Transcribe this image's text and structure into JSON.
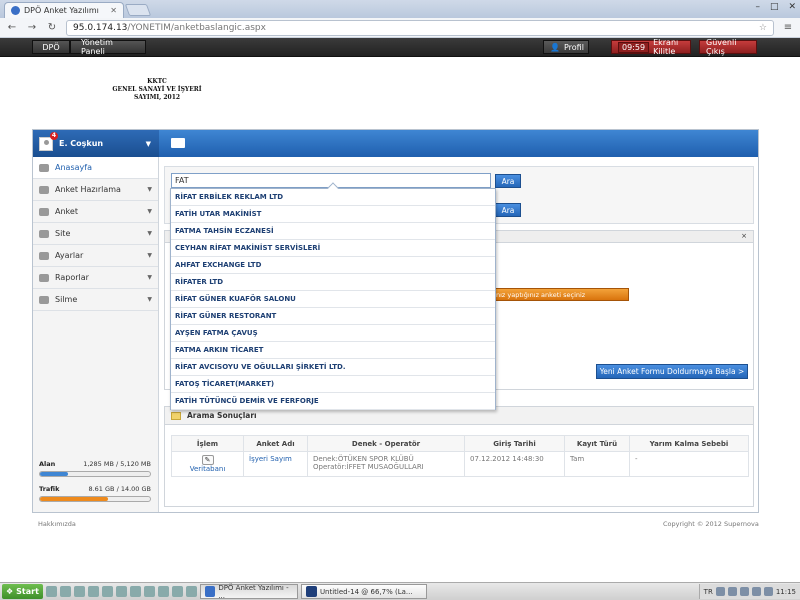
{
  "browser": {
    "tab_title": "DPÖ Anket Yazılımı",
    "url_host": "95.0.174.13",
    "url_path": "/YONETIM/anketbaslangic.aspx"
  },
  "appbar": {
    "crumb_home": "DPÖ",
    "crumb_panel": "Yönetim Paneli",
    "profile": "Profil",
    "timer": "09:59",
    "lock": "Ekranı Kilitle",
    "logout": "Güvenli Çıkış"
  },
  "logo": {
    "line1": "KKTC",
    "line2": "GENEL SANAYİ VE İŞYERİ",
    "line3": "SAYIMI, 2012"
  },
  "user": {
    "name": "E. Coşkun",
    "notifications": "4"
  },
  "sidebar": {
    "items": [
      {
        "label": "Anasayfa"
      },
      {
        "label": "Anket Hazırlama"
      },
      {
        "label": "Anket"
      },
      {
        "label": "Site"
      },
      {
        "label": "Ayarlar"
      },
      {
        "label": "Raporlar"
      },
      {
        "label": "Silme"
      }
    ],
    "stats": {
      "alan_label": "Alan",
      "alan_value": "1,285 MB / 5,120 MB",
      "alan_fraction": 0.25,
      "trafik_label": "Trafik",
      "trafik_value": "8.61 GB / 14.00 GB",
      "trafik_fraction": 0.615
    }
  },
  "search": {
    "value": "FAT",
    "button": "Ara",
    "button2": "Ara"
  },
  "dropdown": {
    "items": [
      "RİFAT ERBİLEK REKLAM LTD",
      "FATİH UTAR MAKİNİST",
      "FATMA TAHSİN ECZANESİ",
      "CEYHAN RİFAT MAKİNİST SERVİSLERİ",
      "AHFAT EXCHANGE LTD",
      "RİFATER LTD",
      "RİFAT GÜNER KUAFÖR SALONU",
      "RİFAT GÜNER RESTORANT",
      "AYŞEN FATMA ÇAVUŞ",
      "FATMA ARKIN TİCARET",
      "RİFAT AVCISOYU VE OĞULLARI ŞİRKETİ LTD.",
      "FATOŞ TİCARET(MARKET)",
      "FATİH TÜTÜNCÜ DEMİR VE FERFORJE"
    ]
  },
  "panel": {
    "orange_button": "...ınız yaptığınız anketi seçiniz",
    "new_form_button": "Yeni Anket Formu Doldurmaya Başla  >",
    "close": "×"
  },
  "results": {
    "title": "Arama Sonuçları",
    "headers": [
      "İşlem",
      "Anket Adı",
      "Denek - Operatör",
      "Giriş Tarihi",
      "Kayıt Türü",
      "Yarım Kalma Sebebi"
    ],
    "row": {
      "action": "Veritabanı",
      "survey": "İşyeri Sayım",
      "subject": "Denek:ÖTÜKEN SPOR KLÜBÜ",
      "operator": "Operatör:İFFET MUSAOĞULLARI",
      "date": "07.12.2012 14:48:30",
      "type": "Tam",
      "reason": "-"
    }
  },
  "footer": {
    "left": "Hakkımızda",
    "right": "Copyright © 2012 Supernova"
  },
  "taskbar": {
    "start": "Start",
    "task1": "DPÖ Anket Yazılımı - ...",
    "task2": "Untitled-14 @ 66,7% (La...",
    "tray_lang": "TR",
    "clock": "11:15"
  }
}
